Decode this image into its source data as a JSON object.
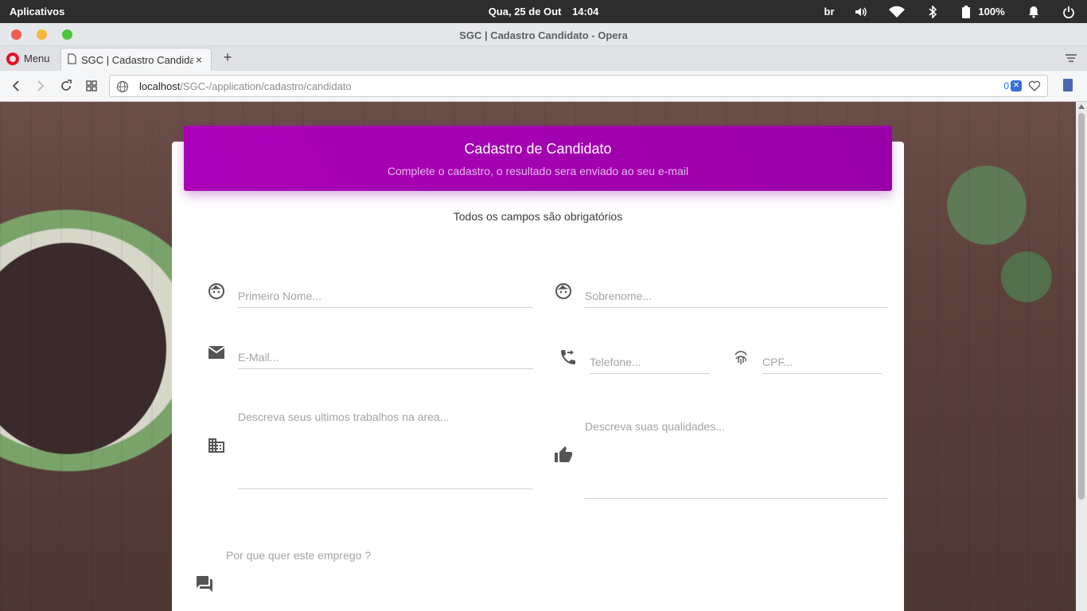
{
  "system": {
    "activities_label": "Aplicativos",
    "date": "Qua, 25 de Out",
    "time": "14:04",
    "keyboard_layout": "br",
    "battery": "100%"
  },
  "window": {
    "title": "SGC | Cadastro Candidato - Opera"
  },
  "browser": {
    "menu_label": "Menu",
    "tab_title": "SGC | Cadastro Candidato",
    "new_tab": "+",
    "close_tab": "×",
    "url_host": "localhost",
    "url_path": "/SGC-/application/cadastro/candidato",
    "blocked_count": "0"
  },
  "page": {
    "header_title": "Cadastro de Candidato",
    "header_subtitle": "Complete o cadastro, o resultado sera enviado ao seu e-mail",
    "required_note": "Todos os campos são obrigatórios",
    "fields": {
      "first_name": "Primeiro Nome...",
      "last_name": "Sobrenome...",
      "email": "E-Mail...",
      "phone": "Telefone...",
      "cpf": "CPF...",
      "experience": "Descreva seus ultimos trabalhos na area...",
      "qualities": "Descreva suas qualidades...",
      "motivation": "Por que quer este emprego ?"
    }
  },
  "colors": {
    "header_purple": "#ab00b8",
    "card_bg": "#ffffff",
    "icon_gray": "#555555"
  },
  "icons": {
    "first_name": "face-icon",
    "last_name": "face-icon",
    "email": "mail-icon",
    "phone": "phone-forwarded-icon",
    "cpf": "fingerprint-icon",
    "experience": "business-icon",
    "qualities": "thumb-up-icon",
    "motivation": "forum-icon"
  }
}
